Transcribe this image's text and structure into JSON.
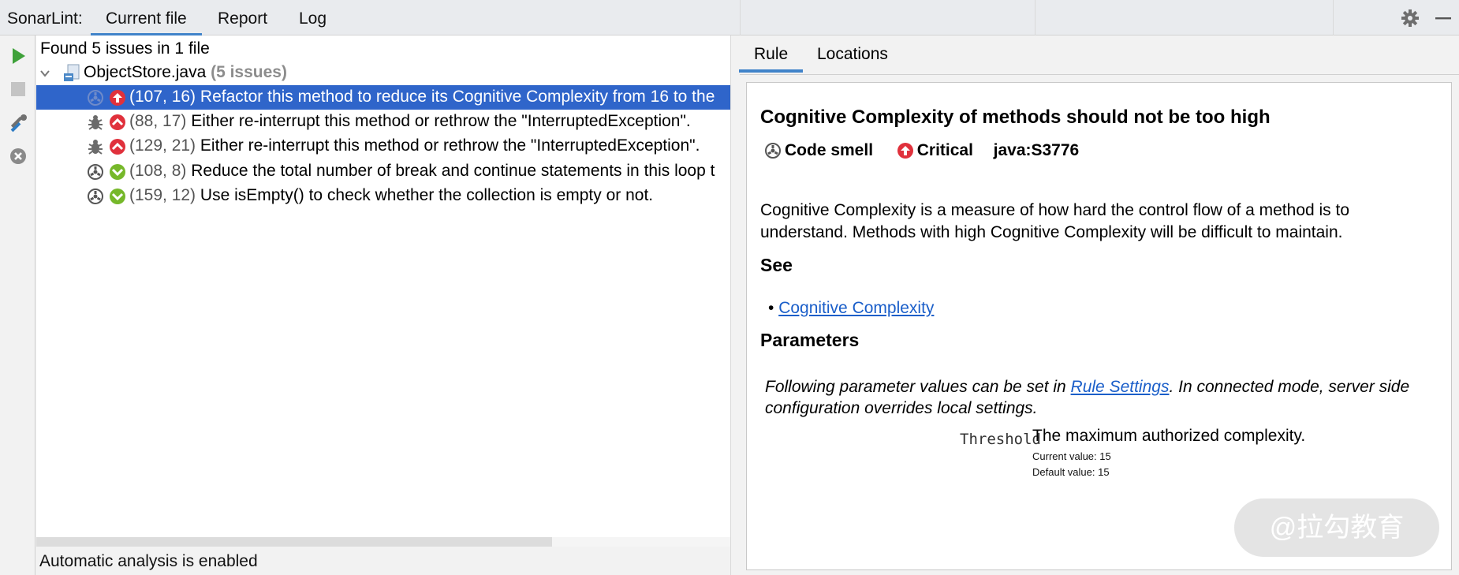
{
  "header": {
    "title": "SonarLint:",
    "tabs": [
      {
        "label": "Current file",
        "active": true
      },
      {
        "label": "Report",
        "active": false
      },
      {
        "label": "Log",
        "active": false
      }
    ],
    "actions": [
      "gear-icon",
      "minimize-icon"
    ]
  },
  "toolbar": {
    "buttons": [
      "run-icon",
      "stop-icon",
      "tools-icon",
      "clear-icon"
    ]
  },
  "tree": {
    "summary": "Found 5 issues in 1 file",
    "file": {
      "name": "ObjectStore.java",
      "count": "(5 issues)"
    },
    "issues": [
      {
        "type": "code-smell",
        "severity": "critical",
        "location": "(107, 16)",
        "message": "Refactor this method to reduce its Cognitive Complexity from 16 to the",
        "selected": true
      },
      {
        "type": "bug",
        "severity": "major",
        "location": "(88, 17)",
        "message": "Either re-interrupt this method or rethrow the \"InterruptedException\".",
        "selected": false
      },
      {
        "type": "bug",
        "severity": "major",
        "location": "(129, 21)",
        "message": "Either re-interrupt this method or rethrow the \"InterruptedException\".",
        "selected": false
      },
      {
        "type": "code-smell",
        "severity": "minor",
        "location": "(108, 8)",
        "message": "Reduce the total number of break and continue statements in this loop t",
        "selected": false
      },
      {
        "type": "code-smell",
        "severity": "minor",
        "location": "(159, 12)",
        "message": "Use isEmpty() to check whether the collection is empty or not.",
        "selected": false
      }
    ]
  },
  "status": "Automatic analysis is enabled",
  "detail": {
    "tabs": [
      {
        "label": "Rule",
        "active": true
      },
      {
        "label": "Locations",
        "active": false
      }
    ],
    "rule": {
      "title": "Cognitive Complexity of methods should not be too high",
      "type": "Code smell",
      "severity": "Critical",
      "key": "java:S3776",
      "description": "Cognitive Complexity is a measure of how hard the control flow of a method is to understand. Methods with high Cognitive Complexity will be difficult to maintain.",
      "see_heading": "See",
      "see_link": "Cognitive Complexity",
      "params_heading": "Parameters",
      "params_note_before": "Following parameter values can be set in ",
      "params_note_link": "Rule Settings",
      "params_note_after": ". In connected mode, server side configuration overrides local settings.",
      "param": {
        "name": "Threshold",
        "description": "The maximum authorized complexity.",
        "current": "Current value: 15",
        "default": "Default value: 15"
      }
    }
  },
  "watermark": "@拉勾教育",
  "colors": {
    "selection": "#2f65ca",
    "accent": "#4083c9",
    "critical": "#e0313c",
    "minor": "#76b82a",
    "link": "#1a5ec9"
  }
}
